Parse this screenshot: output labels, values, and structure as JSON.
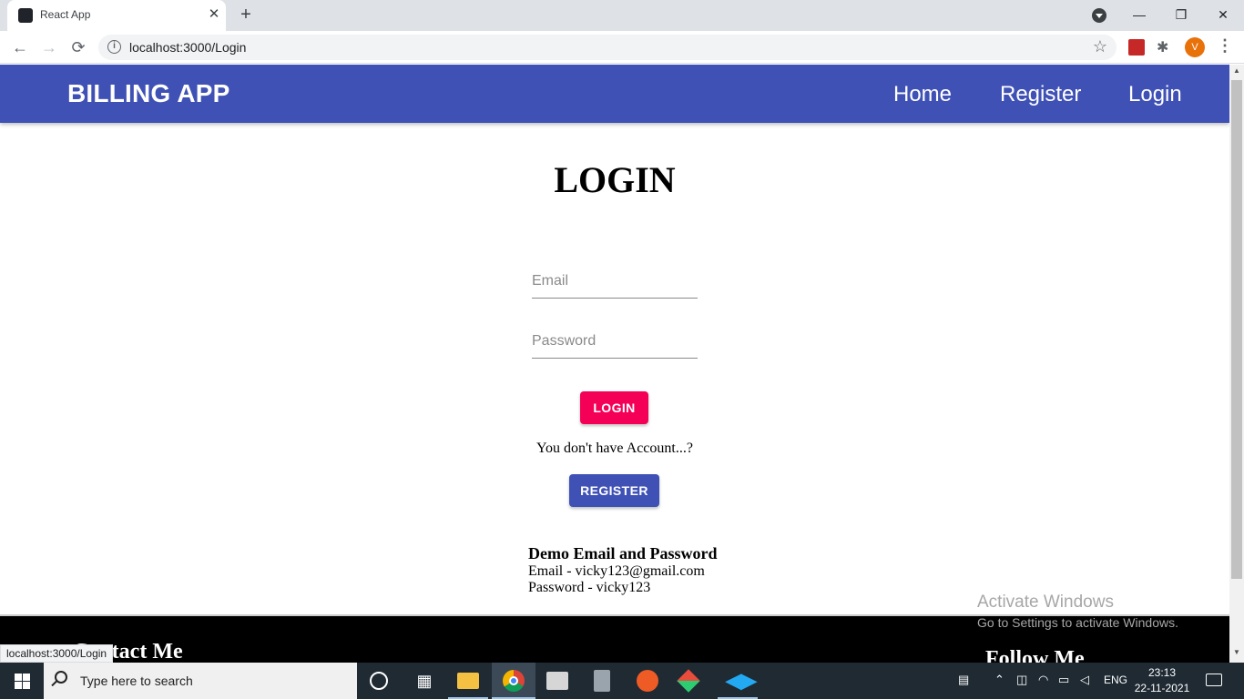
{
  "browser": {
    "tab_title": "React App",
    "tab_close": "✕",
    "new_tab": "+",
    "url": "localhost:3000/Login",
    "avatar_letter": "V",
    "window_minimize": "—",
    "window_restore": "❐",
    "window_close": "✕",
    "status_url": "localhost:3000/Login"
  },
  "navbar": {
    "brand": "BILLING APP",
    "links": [
      "Home",
      "Register",
      "Login"
    ]
  },
  "login": {
    "heading": "LOGIN",
    "email_placeholder": "Email",
    "password_placeholder": "Password",
    "login_button": "LOGIN",
    "no_account_text": "You don't have Account...?",
    "register_button": "REGISTER"
  },
  "demo": {
    "title": "Demo Email and Password",
    "email_line": "Email - vicky123@gmail.com",
    "password_line": "Password - vicky123"
  },
  "footer": {
    "contact_heading": "Contact Me",
    "follow_heading": "Follow Me"
  },
  "watermark": {
    "line1": "Activate Windows",
    "line2": "Go to Settings to activate Windows."
  },
  "taskbar": {
    "search_placeholder": "Type here to search",
    "language": "ENG",
    "time": "23:13",
    "date": "22-11-2021"
  },
  "colors": {
    "appbar": "#3f51b5",
    "login_button": "#f50057",
    "register_button": "#3f51b5",
    "footer": "#000000"
  }
}
